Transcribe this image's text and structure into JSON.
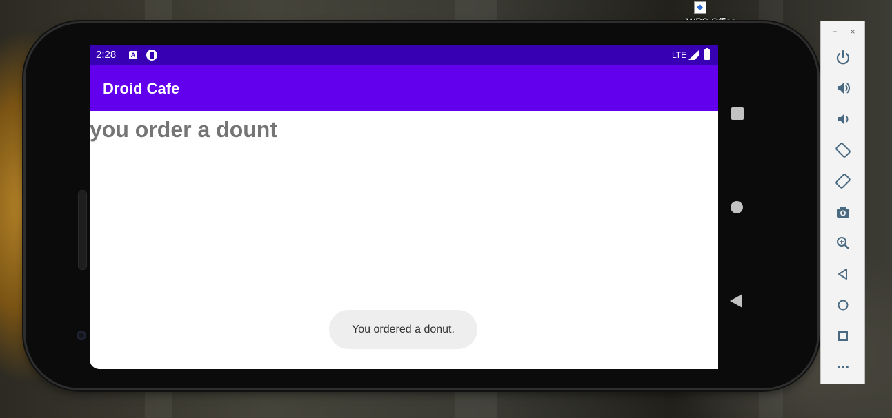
{
  "desktop": {
    "icon_label": "WPS Office"
  },
  "device": {
    "status_bar": {
      "time": "2:28",
      "network": "LTE",
      "notification_a": "A"
    },
    "app_bar": {
      "title": "Droid Cafe"
    },
    "content": {
      "order_text": "you order a dount"
    },
    "toast": {
      "message": "You ordered a donut."
    },
    "nav_buttons": [
      "square-icon",
      "circle-icon",
      "back-triangle-icon"
    ]
  },
  "emulator_toolbar": {
    "window_controls": {
      "minimize": "−",
      "close": "×"
    },
    "buttons": [
      "power-icon",
      "volume-up-icon",
      "volume-down-icon",
      "rotate-left-icon",
      "rotate-right-icon",
      "camera-icon",
      "zoom-icon",
      "back-icon",
      "home-icon",
      "overview-icon",
      "more-icon"
    ]
  },
  "colors": {
    "status_bar": "#3700b3",
    "app_bar": "#6200ee",
    "order_text": "#757575",
    "toast_bg": "#eeeeee"
  }
}
